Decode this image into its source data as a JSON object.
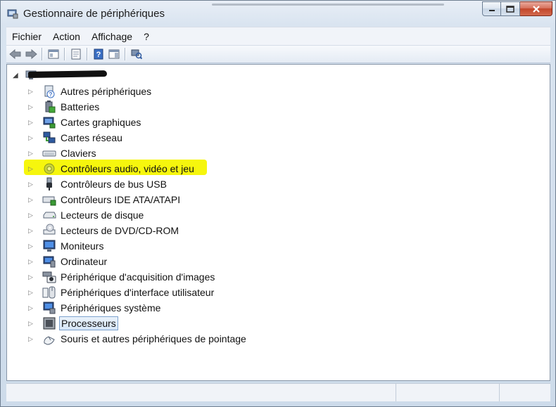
{
  "window": {
    "title": "Gestionnaire de périphériques",
    "controls": [
      "minimize",
      "maximize",
      "close"
    ]
  },
  "menu": {
    "items": [
      "Fichier",
      "Action",
      "Affichage",
      "?"
    ]
  },
  "toolbar": {
    "buttons": [
      "back-icon",
      "forward-icon",
      "console-tree-icon",
      "properties-icon",
      "help-icon",
      "show-hide-pane-icon",
      "scan-hardware-icon"
    ]
  },
  "tree": {
    "root_label": "",
    "items": [
      {
        "label": "Autres périphériques",
        "icon": "unknown-device-icon"
      },
      {
        "label": "Batteries",
        "icon": "battery-icon"
      },
      {
        "label": "Cartes graphiques",
        "icon": "display-adapter-icon"
      },
      {
        "label": "Cartes réseau",
        "icon": "network-adapter-icon"
      },
      {
        "label": "Claviers",
        "icon": "keyboard-icon"
      },
      {
        "label": "Contrôleurs audio, vidéo et jeu",
        "icon": "sound-icon",
        "highlighted": true,
        "highlight_color": "#f5f500"
      },
      {
        "label": "Contrôleurs de bus USB",
        "icon": "usb-icon"
      },
      {
        "label": "Contrôleurs IDE ATA/ATAPI",
        "icon": "ide-controller-icon"
      },
      {
        "label": "Lecteurs de disque",
        "icon": "disk-drive-icon"
      },
      {
        "label": "Lecteurs de DVD/CD-ROM",
        "icon": "dvd-drive-icon"
      },
      {
        "label": "Moniteurs",
        "icon": "monitor-icon"
      },
      {
        "label": "Ordinateur",
        "icon": "computer-icon"
      },
      {
        "label": "Périphérique d'acquisition d'images",
        "icon": "camera-icon"
      },
      {
        "label": "Périphériques d'interface utilisateur",
        "icon": "hid-icon"
      },
      {
        "label": "Périphériques système",
        "icon": "system-device-icon"
      },
      {
        "label": "Processeurs",
        "icon": "processor-icon",
        "selected": true
      },
      {
        "label": "Souris et autres périphériques de pointage",
        "icon": "mouse-icon"
      }
    ]
  },
  "colors": {
    "highlight": "#f5f500",
    "selection_border": "#7da2ce",
    "close_button": "#c2462a"
  }
}
